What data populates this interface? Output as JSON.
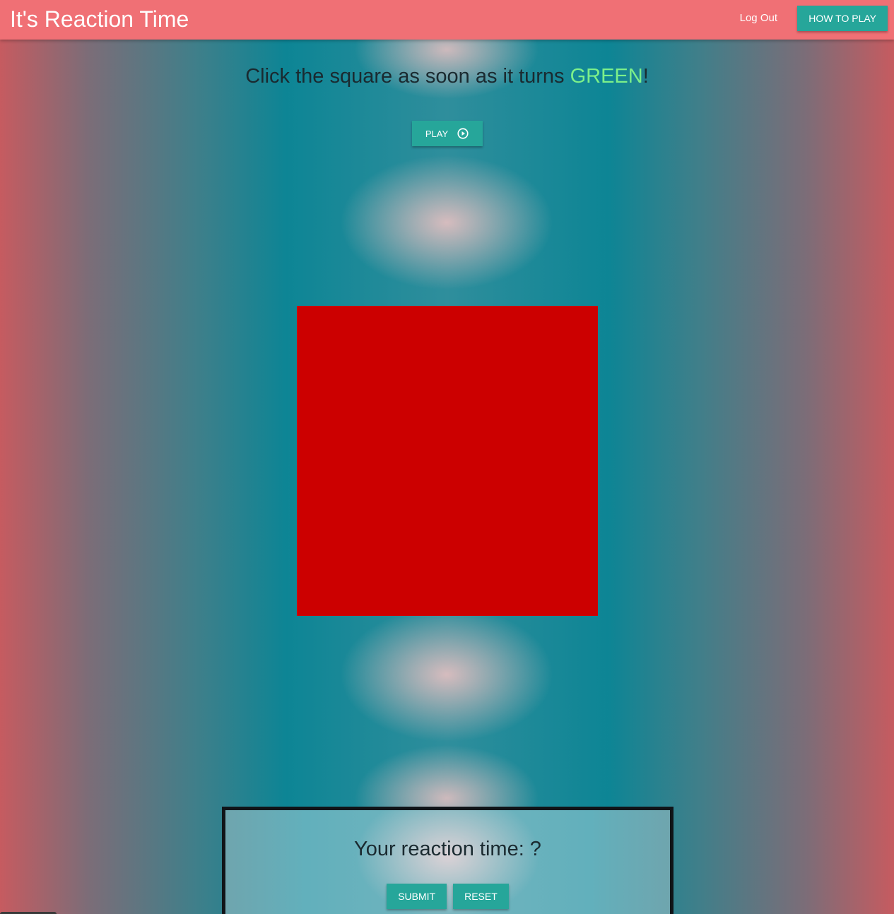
{
  "navbar": {
    "title": "It's Reaction Time",
    "logout_label": "Log Out",
    "how_to_play_label": "HOW TO PLAY"
  },
  "instruction": {
    "prefix": "Click the square as soon as it turns ",
    "highlight": "GREEN",
    "suffix": "!"
  },
  "play_button": {
    "label": "PLAY",
    "icon": "play-circle-icon"
  },
  "square": {
    "color": "#cc0000"
  },
  "result_panel": {
    "text": "Your reaction time: ?",
    "submit_label": "SUBMIT",
    "reset_label": "RESET"
  },
  "colors": {
    "navbar": "#f07075",
    "button": "#26a69a",
    "highlight_green": "#7cf08a"
  }
}
